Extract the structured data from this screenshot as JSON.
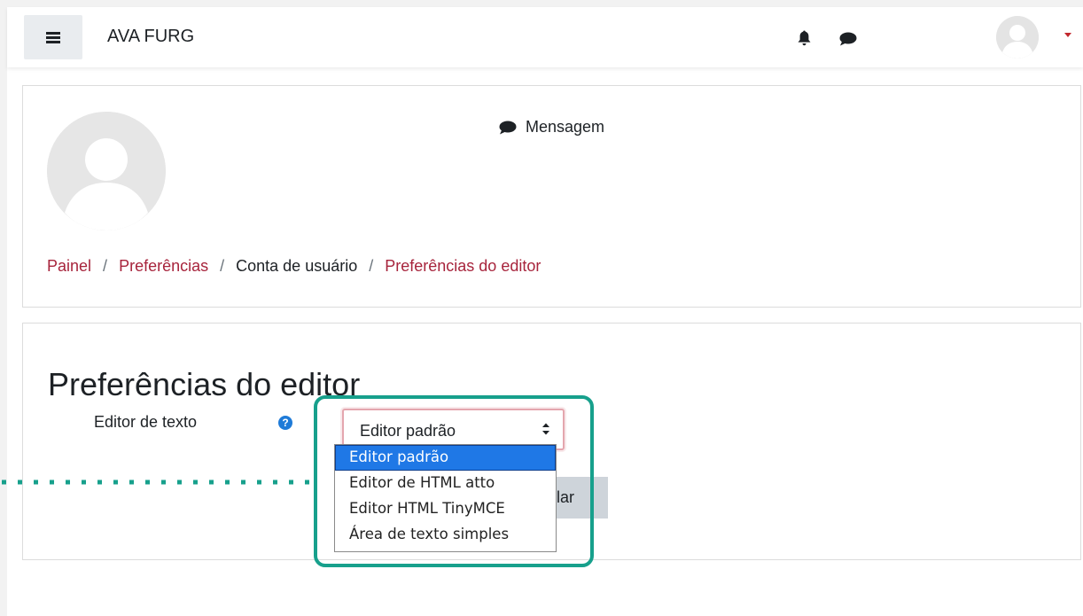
{
  "navbar": {
    "brand": "AVA FURG",
    "menu_icon": "hamburger-icon",
    "notification_icon": "bell-icon",
    "messages_icon": "chat-bubble-icon",
    "user_menu_icon": "caret-down-icon"
  },
  "profile_header": {
    "message_label": "Mensagem",
    "breadcrumb": [
      {
        "label": "Painel",
        "link": true
      },
      {
        "label": "Preferências",
        "link": true
      },
      {
        "label": "Conta de usuário",
        "link": false
      },
      {
        "label": "Preferências do editor",
        "link": true
      }
    ],
    "breadcrumb_separator": "/"
  },
  "form": {
    "title": "Preferências do editor",
    "field_label": "Editor de texto",
    "help_icon": "question-circle-icon",
    "select_value": "Editor padrão",
    "options": [
      "Editor padrão",
      "Editor de HTML atto",
      "Editor HTML TinyMCE",
      "Área de texto simples"
    ],
    "selected_index": 0,
    "cancel_label_visible": "elar"
  },
  "colors": {
    "link": "#a7243c",
    "highlight": "#17a08c",
    "option_selected": "#1f78e6",
    "help": "#1f7bd8"
  }
}
